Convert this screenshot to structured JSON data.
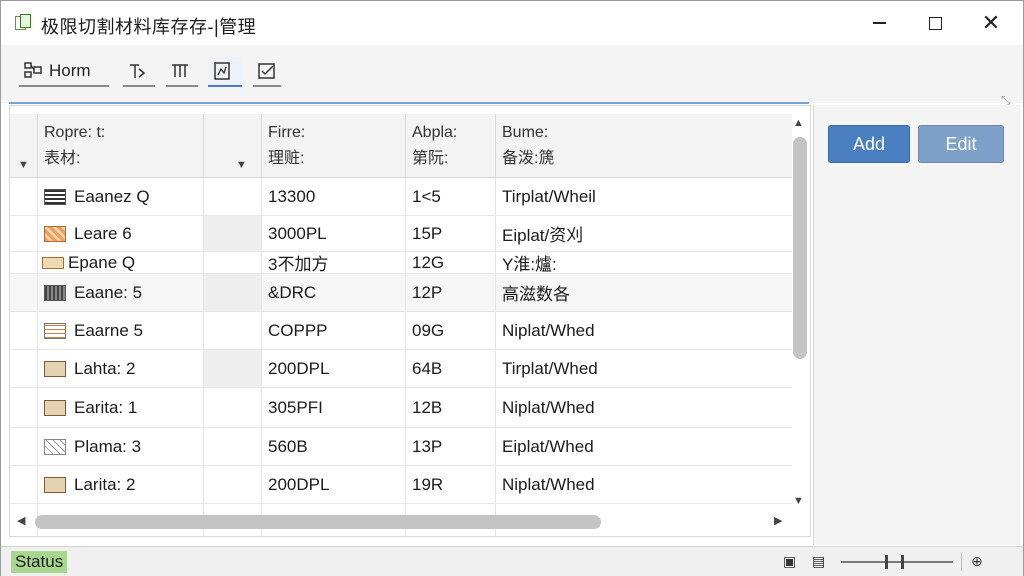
{
  "window": {
    "title": "极限切割材料库存存-|管理"
  },
  "toolbar": {
    "home_label": "Horm"
  },
  "grid": {
    "headers": [
      {
        "line1": "Ropre: t:",
        "line2": "表材:"
      },
      {
        "line1": "",
        "line2": ""
      },
      {
        "line1": "Firre:",
        "line2": "理赃:"
      },
      {
        "line1": "Abpla:",
        "line2": "第阮:"
      },
      {
        "line1": "Bume:",
        "line2": "备泼:篪"
      }
    ],
    "rows": [
      {
        "icon": "striped-material-icon",
        "name": "Eaanez Q",
        "col3": "13300",
        "col4": "1<5",
        "col5": "Tirplat/Wheil"
      },
      {
        "icon": "orange-material-icon",
        "name": "Leare 6",
        "col3": "3000PL",
        "col4": "15P",
        "col5": "Eiplat/资刈"
      },
      {
        "icon": "tan-material-icon",
        "name": "Epane Q",
        "col3": "3不加方",
        "col4": "12G",
        "col5": "Y淮:爐:"
      },
      {
        "icon": "dark-material-icon",
        "name": "Eaane: 5",
        "col3": "&DRC",
        "col4": "12P",
        "col5": "高滋数各"
      },
      {
        "icon": "lined-material-icon",
        "name": "Eaarne 5",
        "col3": "COPPP",
        "col4": "09G",
        "col5": "Niplat/Whed"
      },
      {
        "icon": "wood-material-icon",
        "name": "Lahta: 2",
        "col3": "200DPL",
        "col4": "64B",
        "col5": "Tirplat/Whed"
      },
      {
        "icon": "wood-material-icon",
        "name": "Earita: 1",
        "col3": "305PFI",
        "col4": "12B",
        "col5": "Niplat/Whed"
      },
      {
        "icon": "cross-material-icon",
        "name": "Plama: 3",
        "col3": "560B",
        "col4": "13P",
        "col5": "Eiplat/Whed"
      },
      {
        "icon": "wood-material-icon",
        "name": "Larita: 2",
        "col3": "200DPL",
        "col4": "19R",
        "col5": "Niplat/Whed"
      }
    ]
  },
  "side": {
    "add_label": "Add",
    "edit_label": "Edit"
  },
  "status": {
    "label": "Status"
  },
  "colors": {
    "accent": "#4a7fc2",
    "status_bg": "#a8d890"
  }
}
